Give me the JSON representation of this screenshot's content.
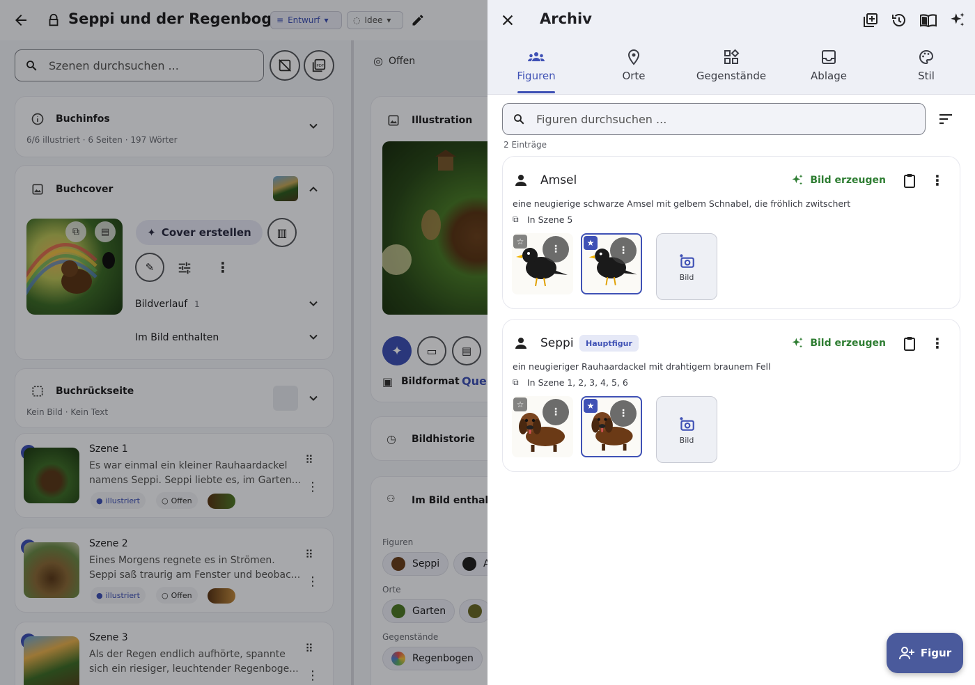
{
  "left": {
    "title": "Seppi und der Regenbogen",
    "status_chip": "Entwurf",
    "idea_chip": "Idee",
    "scene_search_placeholder": "Szenen durchsuchen ...",
    "bookinfo": {
      "title": "Buchinfos",
      "sub": "6/6 illustriert · 6 Seiten · 197 Wörter"
    },
    "cover": {
      "title": "Buchcover",
      "create_label": "Cover erstellen",
      "history_label": "Bildverlauf",
      "history_count": "1",
      "contains_label": "Im Bild enthalten"
    },
    "backcover": {
      "title": "Buchrückseite",
      "sub": "Kein Bild · Kein Text"
    },
    "scenes": [
      {
        "num": "1",
        "title": "Szene 1",
        "line1": "Es war einmal ein kleiner Rauhaardackel",
        "line2": "namens Seppi. Seppi liebte es, im Garten...",
        "badge_done": "illustriert",
        "badge_open": "Offen"
      },
      {
        "num": "2",
        "title": "Szene 2",
        "line1": "Eines Morgens regnete es in Strömen.",
        "line2": "Seppi saß traurig am Fenster und beobac...",
        "badge_done": "illustriert",
        "badge_open": "Offen"
      },
      {
        "num": "3",
        "title": "Szene 3",
        "line1": "Als der Regen endlich aufhörte, spannte",
        "line2": "sich ein riesiger, leuchtender Regenboge..."
      }
    ],
    "mid": {
      "status": "Offen",
      "illustration": "Illustration",
      "format_label": "Bildformat",
      "format_value": "Quer",
      "history": "Bildhistorie",
      "contains": "Im Bild enthalte",
      "figures_label": "Figuren",
      "figure_chips": [
        "Seppi",
        "A"
      ],
      "places_label": "Orte",
      "place_chips": [
        "Garten"
      ],
      "items_label": "Gegenstände",
      "item_chips": [
        "Regenbogen"
      ]
    }
  },
  "drawer": {
    "title": "Archiv",
    "tabs": [
      {
        "label": "Figuren",
        "icon": "groups-icon",
        "active": true
      },
      {
        "label": "Orte",
        "icon": "location-pin-icon",
        "active": false
      },
      {
        "label": "Gegenstände",
        "icon": "widgets-icon",
        "active": false
      },
      {
        "label": "Ablage",
        "icon": "inbox-icon",
        "active": false
      },
      {
        "label": "Stil",
        "icon": "palette-icon",
        "active": false
      }
    ],
    "search_placeholder": "Figuren durchsuchen ...",
    "count": "2 Einträge",
    "entries": [
      {
        "name": "Amsel",
        "badge": "",
        "generate": "Bild erzeugen",
        "desc": "eine neugierige schwarze Amsel mit gelbem Schnabel, die fröhlich zwitschert",
        "scenes": "In Szene 5",
        "add_label": "Bild"
      },
      {
        "name": "Seppi",
        "badge": "Hauptfigur",
        "generate": "Bild erzeugen",
        "desc": "ein neugieriger Rauhaardackel mit drahtigem braunem Fell",
        "scenes": "In Szene 1, 2, 3, 4, 5, 6",
        "add_label": "Bild"
      }
    ],
    "fab_label": "Figur"
  },
  "colors": {
    "accent": "#3f51b5",
    "generate_green": "#2e7d32",
    "fab": "#4a5a9c"
  }
}
